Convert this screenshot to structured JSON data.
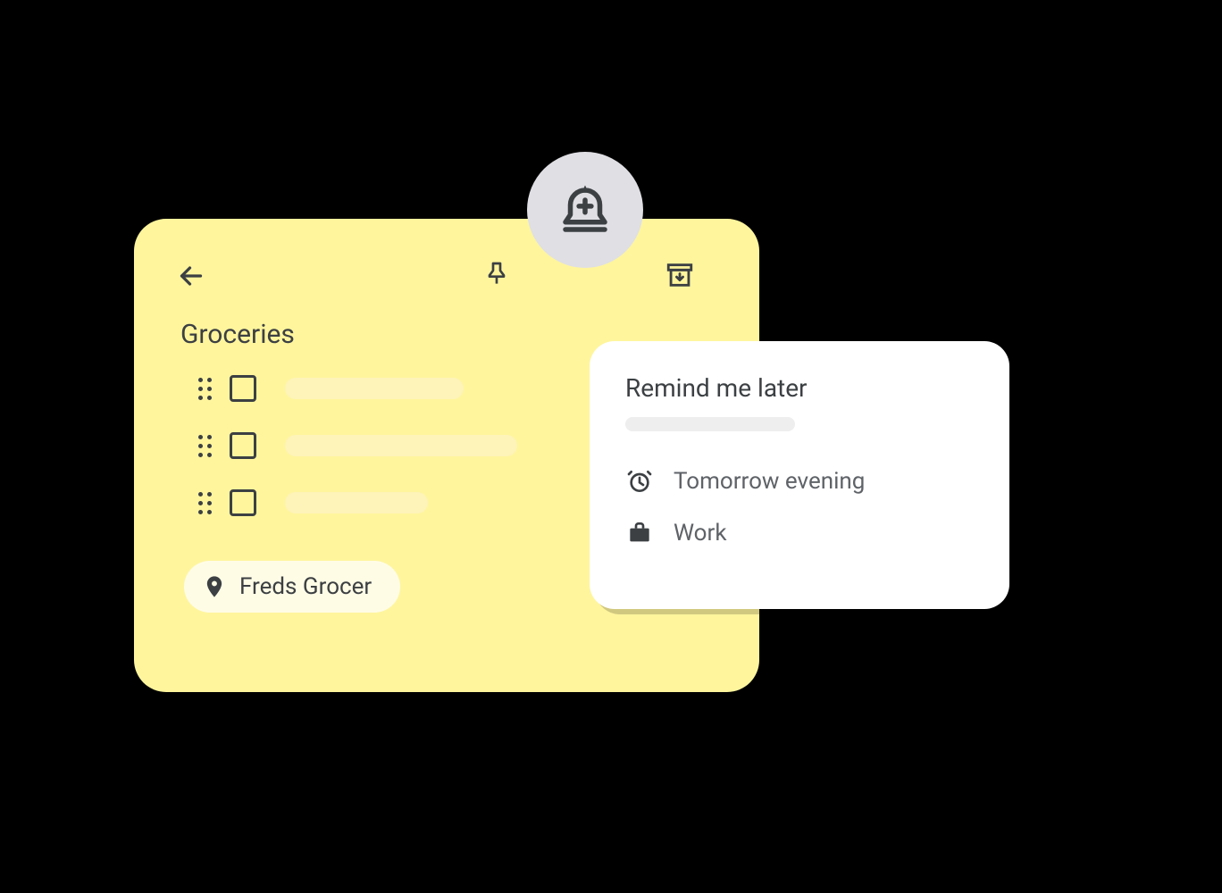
{
  "note": {
    "title": "Groceries",
    "location_label": "Freds Grocer"
  },
  "reminder": {
    "title": "Remind me later",
    "option_time": "Tomorrow evening",
    "option_place": "Work"
  },
  "colors": {
    "note_bg": "#FFF59D",
    "icon": "#3c4043",
    "bell_circle": "#DFDFE4"
  }
}
